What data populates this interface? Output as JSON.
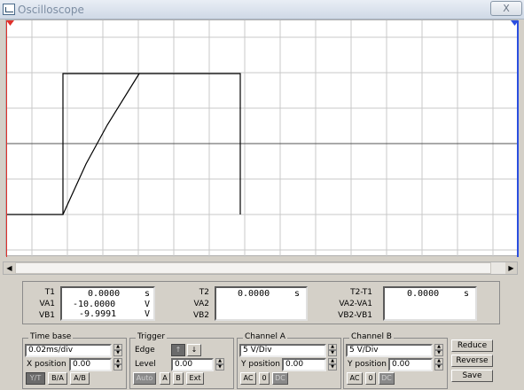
{
  "window": {
    "title": "Oscilloscope",
    "close_label": "X"
  },
  "screen": {
    "marker_t1": "1",
    "marker_t2": "2"
  },
  "readout": {
    "t1": {
      "label": "T1",
      "time": "0.0000",
      "time_unit": "s",
      "va_label": "VA1",
      "va": "-10.0000",
      "va_unit": "V",
      "vb_label": "VB1",
      "vb": "-9.9991",
      "vb_unit": "V"
    },
    "t2": {
      "label": "T2",
      "time": "0.0000",
      "time_unit": "s",
      "va_label": "VA2",
      "vb_label": "VB2"
    },
    "diff": {
      "label": "T2-T1",
      "time": "0.0000",
      "time_unit": "s",
      "va_label": "VA2-VA1",
      "vb_label": "VB2-VB1"
    }
  },
  "timebase": {
    "title": "Time base",
    "value": "0.02ms/div",
    "xpos_label": "X position",
    "xpos": "0.00",
    "mode_yt": "Y/T",
    "mode_ba": "B/A",
    "mode_ab": "A/B"
  },
  "trigger": {
    "title": "Trigger",
    "edge_label": "Edge",
    "edge_rise": "↑",
    "edge_fall": "↓",
    "level_label": "Level",
    "level": "0.00",
    "src_auto": "Auto",
    "src_a": "A",
    "src_b": "B",
    "src_ext": "Ext"
  },
  "channel_a": {
    "title": "Channel A",
    "vdiv": "5 V/Div",
    "ypos_label": "Y position",
    "ypos": "0.00",
    "ac": "AC",
    "zero": "0",
    "dc": "DC"
  },
  "channel_b": {
    "title": "Channel B",
    "vdiv": "5 V/Div",
    "ypos_label": "Y position",
    "ypos": "0.00",
    "ac": "AC",
    "zero": "0",
    "dc": "DC"
  },
  "actions": {
    "reduce": "Reduce",
    "reverse": "Reverse",
    "save": "Save"
  }
}
